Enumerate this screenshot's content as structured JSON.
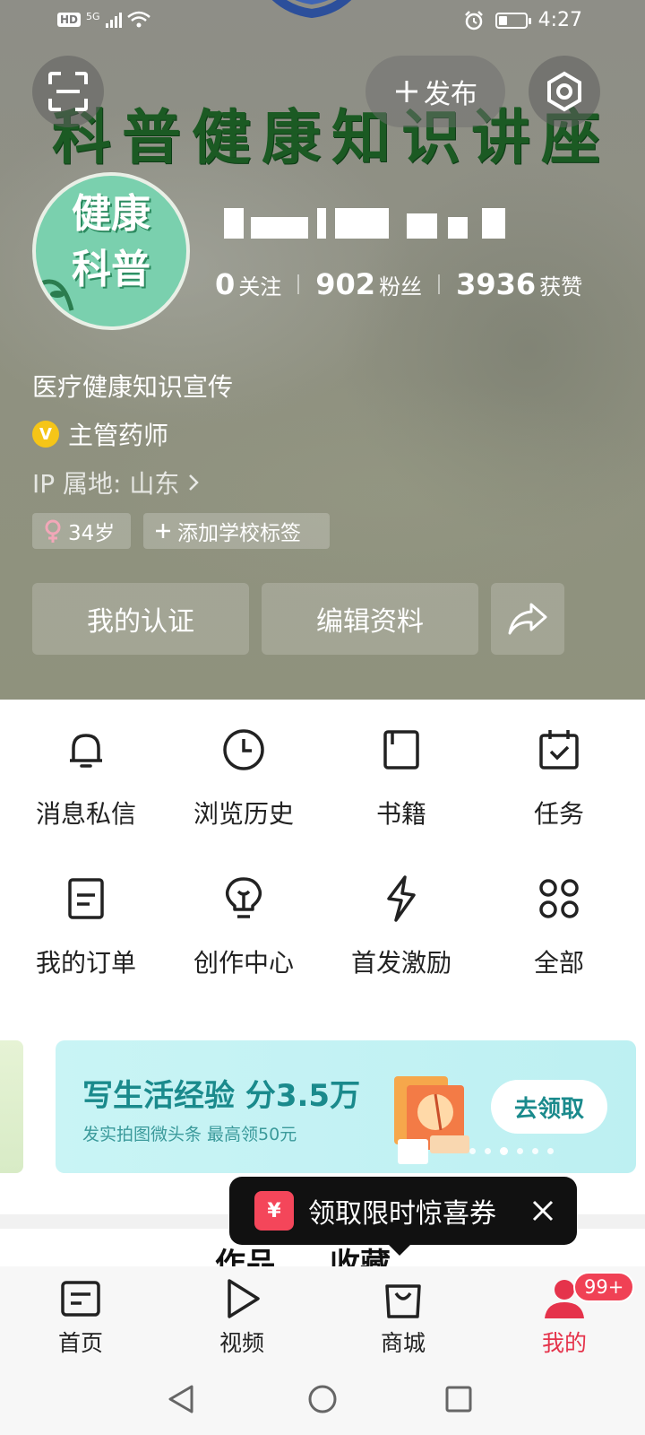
{
  "status_bar": {
    "hd": "HD",
    "network": "5G",
    "time": "4:27"
  },
  "header": {
    "banner_text": "科普健康知识讲座",
    "publish_label": "发布",
    "avatar_text_line1": "健康",
    "avatar_text_line2": "科普"
  },
  "profile": {
    "stats": [
      {
        "value": "0",
        "label": "关注"
      },
      {
        "value": "902",
        "label": "粉丝"
      },
      {
        "value": "3936",
        "label": "获赞"
      }
    ],
    "bio": "医疗健康知识宣传",
    "verification": {
      "badge": "V",
      "title": "主管药师"
    },
    "ip_location": "IP 属地: 山东",
    "tags": [
      {
        "label": "34岁"
      },
      {
        "label": "添加学校标签"
      }
    ],
    "actions": {
      "certify": "我的认证",
      "edit": "编辑资料"
    }
  },
  "quick_menu": [
    {
      "label": "消息私信",
      "icon": "bell-icon"
    },
    {
      "label": "浏览历史",
      "icon": "clock-icon"
    },
    {
      "label": "书籍",
      "icon": "book-icon"
    },
    {
      "label": "任务",
      "icon": "calendar-check-icon"
    },
    {
      "label": "我的订单",
      "icon": "order-icon"
    },
    {
      "label": "创作中心",
      "icon": "lightbulb-icon"
    },
    {
      "label": "首发激励",
      "icon": "lightning-icon"
    },
    {
      "label": "全部",
      "icon": "grid-icon"
    }
  ],
  "promo": {
    "title": "写生活经验 分3.5万",
    "subtitle": "发实拍图微头条 最高领50元",
    "button": "去领取"
  },
  "section_tabs": {
    "works": "作品",
    "favorites": "收藏"
  },
  "toast": {
    "icon_text": "¥",
    "text": "领取限时惊喜券"
  },
  "tabbar": {
    "items": [
      {
        "label": "首页",
        "icon": "home-doc-icon"
      },
      {
        "label": "视频",
        "icon": "play-icon"
      },
      {
        "label": "商城",
        "icon": "shopping-bag-icon"
      },
      {
        "label": "我的",
        "icon": "user-icon"
      }
    ],
    "badge": "99+",
    "active_color": "#e5334b"
  }
}
